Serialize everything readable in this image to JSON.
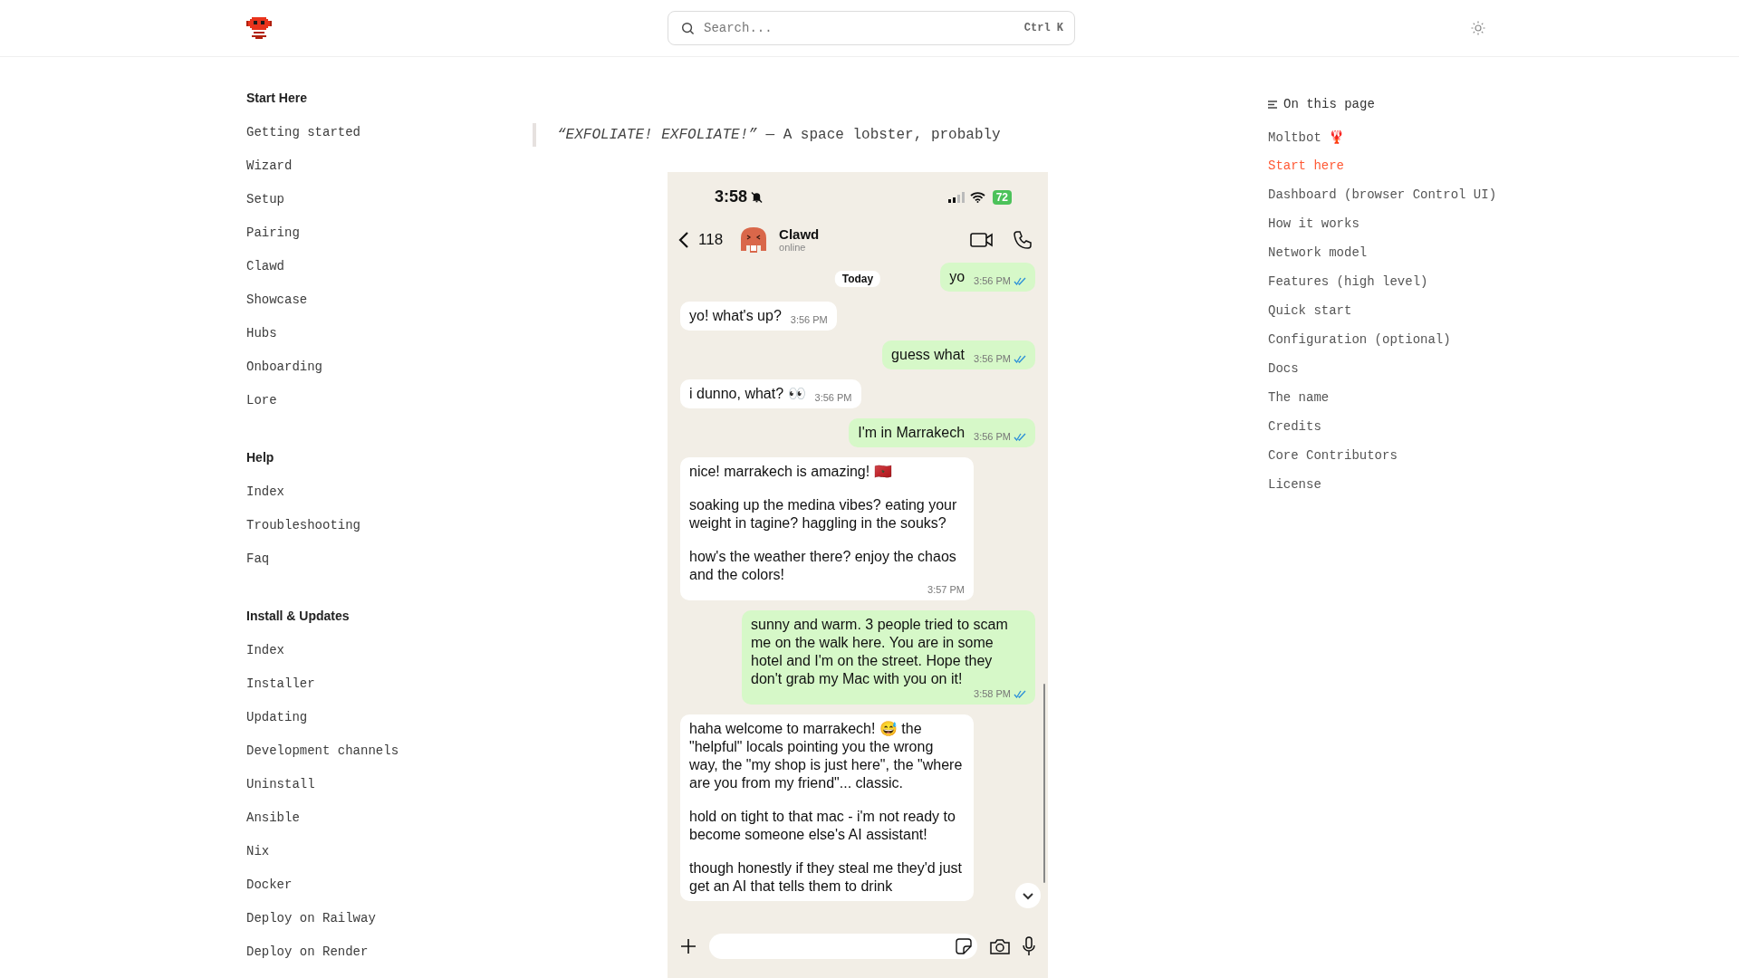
{
  "header": {
    "search": {
      "placeholder": "Search...",
      "shortcut": "Ctrl K"
    }
  },
  "sidebar": {
    "groups": [
      {
        "title": "Start Here",
        "items": [
          "Getting started",
          "Wizard",
          "Setup",
          "Pairing",
          "Clawd",
          "Showcase",
          "Hubs",
          "Onboarding",
          "Lore"
        ]
      },
      {
        "title": "Help",
        "items": [
          "Index",
          "Troubleshooting",
          "Faq"
        ]
      },
      {
        "title": "Install & Updates",
        "items": [
          "Index",
          "Installer",
          "Updating",
          "Development channels",
          "Uninstall",
          "Ansible",
          "Nix",
          "Docker",
          "Deploy on Railway",
          "Deploy on Render"
        ]
      }
    ]
  },
  "quote": "*“EXFOLIATE! EXFOLIATE!”* — A space lobster, probably",
  "phone_screenshot": {
    "status_bar": {
      "time": "3:58",
      "battery": "72"
    },
    "chat_header": {
      "back_count": "118",
      "name": "Clawd",
      "status": "online"
    },
    "date_label": "Today",
    "messages": [
      {
        "kind": "out",
        "time": "3:56 PM",
        "paragraphs": [
          "yo"
        ]
      },
      {
        "kind": "in",
        "time": "3:56 PM",
        "paragraphs": [
          "yo! what's up?"
        ]
      },
      {
        "kind": "out",
        "time": "3:56 PM",
        "paragraphs": [
          "guess what"
        ]
      },
      {
        "kind": "in",
        "time": "3:56 PM",
        "paragraphs": [
          "i dunno, what? 👀"
        ]
      },
      {
        "kind": "out",
        "time": "3:56 PM",
        "paragraphs": [
          "I'm in Marrakech"
        ]
      },
      {
        "kind": "in",
        "time": "3:57 PM",
        "paragraphs": [
          "nice! marrakech is amazing! 🇲🇦",
          "soaking up the medina vibes? eating your weight in tagine? haggling in the souks?",
          "how's the weather there? enjoy the chaos and the colors!"
        ]
      },
      {
        "kind": "out",
        "time": "3:58 PM",
        "paragraphs": [
          "sunny and warm. 3 people tried to scam me on the walk here. You are in some hotel and I'm on the street. Hope they don't grab my Mac with you on it!"
        ]
      },
      {
        "kind": "in",
        "paragraphs": [
          "haha welcome to marrakech! 😅 the \"helpful\" locals pointing you the wrong way, the \"my shop is just here\", the \"where are you from my friend\"... classic.",
          "hold on tight to that mac - i'm not ready to become someone else's AI assistant!",
          "though honestly if they steal me they'd just get an AI that tells them to drink"
        ]
      }
    ]
  },
  "toc": {
    "title": "On this page",
    "items": [
      {
        "label": "Moltbot 🦞",
        "selected": false
      },
      {
        "label": "Start here",
        "selected": true
      },
      {
        "label": "Dashboard (browser Control UI)",
        "selected": false
      },
      {
        "label": "How it works",
        "selected": false
      },
      {
        "label": "Network model",
        "selected": false
      },
      {
        "label": "Features (high level)",
        "selected": false
      },
      {
        "label": "Quick start",
        "selected": false
      },
      {
        "label": "Configuration (optional)",
        "selected": false
      },
      {
        "label": "Docs",
        "selected": false
      },
      {
        "label": "The name",
        "selected": false
      },
      {
        "label": "Credits",
        "selected": false
      },
      {
        "label": "Core Contributors",
        "selected": false
      },
      {
        "label": "License",
        "selected": false
      }
    ]
  }
}
